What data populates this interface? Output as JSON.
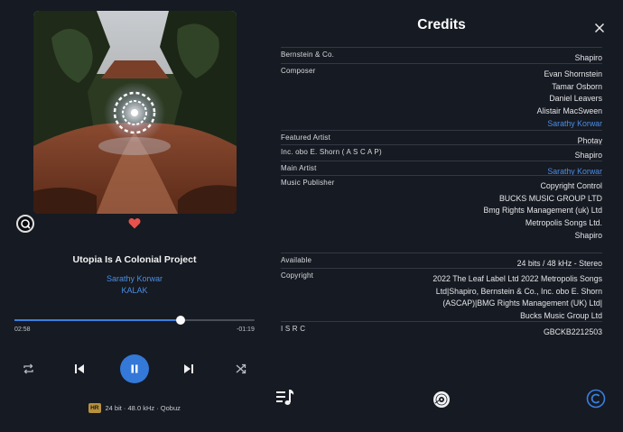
{
  "player": {
    "track_title": "Utopia Is A Colonial Project",
    "artist": "Sarathy Korwar",
    "album": "KALAK",
    "elapsed": "02:58",
    "remaining": "-01:19",
    "progress": 0.693,
    "quality_badge": "HR",
    "quality_text": "24 bit · 48.0 kHz · Qobuz",
    "liked": true
  },
  "icons": {
    "qobuz": "qobuz-icon",
    "heart": "heart-icon",
    "repeat": "repeat-icon",
    "previous": "skip-previous-icon",
    "pause": "pause-icon",
    "next": "skip-next-icon",
    "shuffle": "shuffle-icon",
    "close": "close-icon",
    "lyrics": "lyrics-icon",
    "disc": "disc-icon",
    "credits": "credits-icon"
  },
  "colors": {
    "accent": "#3478d8",
    "link": "#4b8ee6",
    "heart": "#e8524a",
    "background": "#161a22"
  },
  "credits": {
    "title": "Credits",
    "rows": [
      {
        "label": "Bernstein &  Co.",
        "values": [
          {
            "text": "Shapiro"
          }
        ]
      },
      {
        "label": "Composer",
        "values": [
          {
            "text": "Evan Shornstein"
          },
          {
            "text": "Tamar Osborn"
          },
          {
            "text": "Daniel Leavers"
          },
          {
            "text": "Alistair MacSween"
          },
          {
            "text": "Sarathy Korwar",
            "link": true
          }
        ]
      },
      {
        "label": "Featured Artist",
        "values": [
          {
            "text": "Photay"
          }
        ]
      },
      {
        "label": "Inc. obo  E.  Shorn ( A S C A P)",
        "values": [
          {
            "text": "Shapiro"
          }
        ]
      },
      {
        "label": "Main Artist",
        "values": [
          {
            "text": "Sarathy Korwar",
            "link": true
          }
        ]
      },
      {
        "label": "Music Publisher",
        "values": [
          {
            "text": "Copyright Control"
          },
          {
            "text": "BUCKS MUSIC GROUP LTD"
          },
          {
            "text": "Bmg Rights Management (uk) Ltd"
          },
          {
            "text": "Metropolis Songs Ltd."
          },
          {
            "text": "Shapiro"
          }
        ]
      },
      {
        "label": "Available",
        "values": [
          {
            "text": "24 bits / 48 kHz - Stereo"
          }
        ]
      },
      {
        "label": "Copyright",
        "values": [
          {
            "text": "2022 The Leaf Label Ltd 2022 Metropolis Songs"
          },
          {
            "text": "Ltd|Shapiro, Bernstein & Co., Inc. obo E. Shorn"
          },
          {
            "text": "(ASCAP)|BMG Rights Management (UK) Ltd|"
          },
          {
            "text": "Bucks Music Group Ltd"
          }
        ]
      },
      {
        "label": "I S R C",
        "values": [
          {
            "text": "GBCKB2212503"
          }
        ]
      }
    ]
  }
}
